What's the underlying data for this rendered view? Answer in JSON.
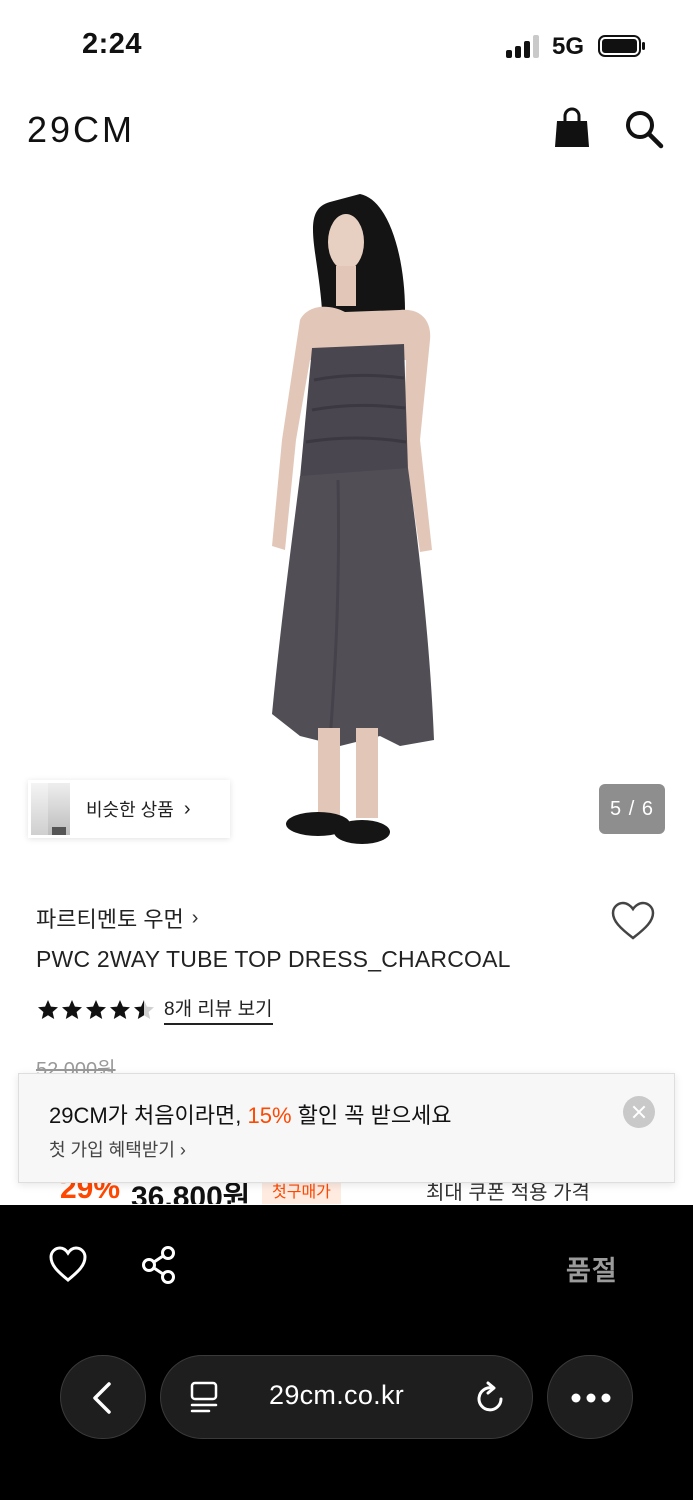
{
  "status_bar": {
    "time": "2:24",
    "network": "5G",
    "icons": [
      "signal-icon",
      "battery-icon"
    ]
  },
  "header": {
    "logo": "29CM",
    "icons": [
      "shopping-bag-icon",
      "search-icon"
    ]
  },
  "gallery": {
    "image_description_icon": "product-photo",
    "counter": "5 / 6",
    "similar_products_label": "비슷한 상품",
    "similar_products_chevron": "›"
  },
  "product": {
    "brand": "파르티멘토 우먼",
    "brand_chevron": "›",
    "name": "PWC 2WAY TUBE TOP DRESS_CHARCOAL",
    "rating": 4.5,
    "rating_max": 5,
    "review_link": "8개 리뷰 보기",
    "original_price": "52,000원",
    "discount_percent": "29%",
    "sale_price": "36,800원",
    "sale_badge": "첫구매가",
    "coupon_text": "최대 쿠폰 적용 가격"
  },
  "promo": {
    "title_prefix": "29CM가 처음이라면, ",
    "title_accent": "15%",
    "title_suffix": " 할인 꼭 받으세요",
    "subtitle": "첫 가입 혜택받기 ›",
    "accent_color": "#ff4800"
  },
  "action_bar": {
    "status": "품절",
    "icons": [
      "heart-icon",
      "share-icon"
    ]
  },
  "browser": {
    "url": "29cm.co.kr",
    "icons": [
      "back-icon",
      "reader-icon",
      "reload-icon",
      "more-icon"
    ]
  }
}
